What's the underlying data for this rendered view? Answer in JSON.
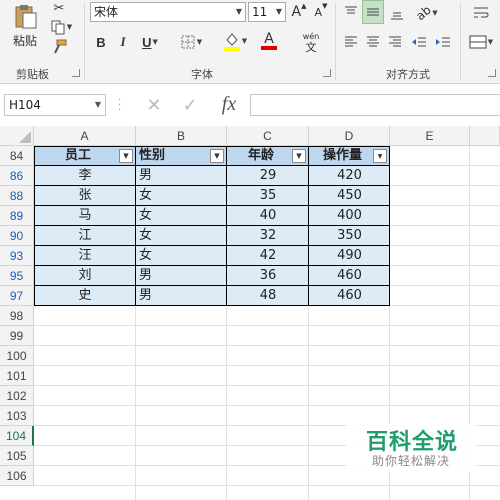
{
  "ribbon": {
    "clipboard": {
      "paste_label": "粘贴",
      "group_label": "剪贴板"
    },
    "font": {
      "name": "宋体",
      "size": "11",
      "grow_label": "A",
      "shrink_label": "A",
      "bold": "B",
      "italic": "I",
      "underline": "U",
      "font_color_glyph": "A",
      "pinyin_top": "wén",
      "pinyin_bottom": "文",
      "group_label": "字体"
    },
    "alignment": {
      "group_label": "对齐方式"
    }
  },
  "formula_bar": {
    "name_box": "H104",
    "cancel_glyph": "✕",
    "enter_glyph": "✓",
    "fx_label": "fx",
    "formula_value": ""
  },
  "grid": {
    "columns": [
      "A",
      "B",
      "C",
      "D",
      "E"
    ],
    "row_numbers": [
      "84",
      "86",
      "88",
      "89",
      "90",
      "93",
      "95",
      "97",
      "98",
      "99",
      "100",
      "101",
      "102",
      "103",
      "104",
      "105",
      "106"
    ],
    "headers": [
      "员工",
      "性别",
      "年龄",
      "操作量"
    ],
    "rows": [
      [
        "李",
        "男",
        "29",
        "420"
      ],
      [
        "张",
        "女",
        "35",
        "450"
      ],
      [
        "马",
        "女",
        "40",
        "400"
      ],
      [
        "江",
        "女",
        "32",
        "350"
      ],
      [
        "汪",
        "女",
        "42",
        "490"
      ],
      [
        "刘",
        "男",
        "36",
        "460"
      ],
      [
        "史",
        "男",
        "48",
        "460"
      ]
    ],
    "active_row": "104"
  },
  "colors": {
    "table_header": "#bdd7ee",
    "table_body": "#ddebf7",
    "filtered_row_number": "#1c5fb8",
    "active": "#217346"
  },
  "watermark": {
    "title": "百科全说",
    "subtitle": "助你轻松解决"
  }
}
